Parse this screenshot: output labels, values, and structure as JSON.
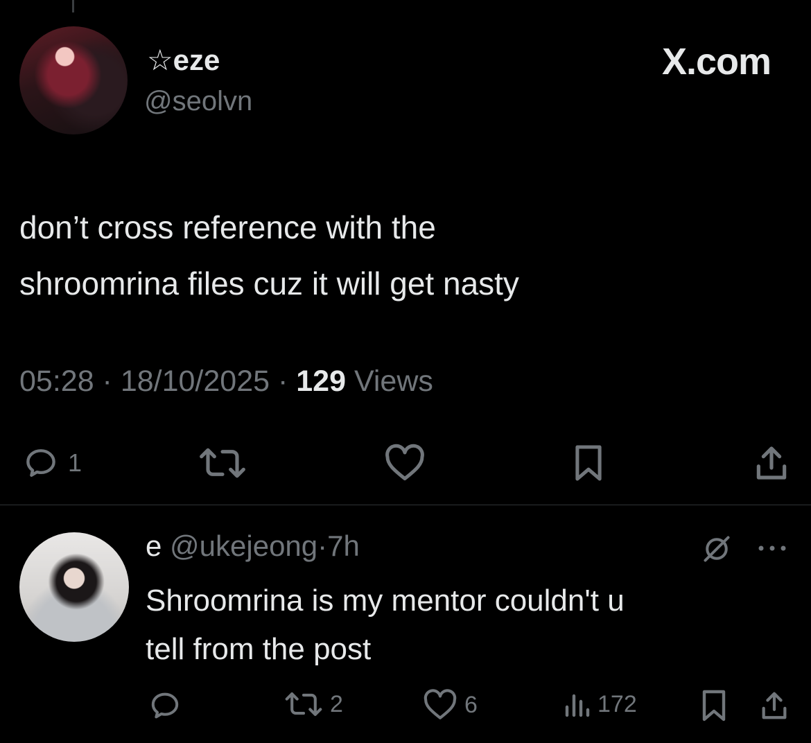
{
  "main_post": {
    "display_name": "☆eze",
    "handle": "@seolvn",
    "brand": "X.com",
    "text_line1": "don’t cross reference with the",
    "text_line2": "shroomrina files cuz it will get nasty",
    "time": "05:28",
    "separator": " · ",
    "date": "18/10/2025",
    "views_count": "129",
    "views_label": " Views",
    "actions": {
      "reply_count": "1"
    },
    "icons": [
      "reply-icon",
      "retweet-icon",
      "like-icon",
      "bookmark-icon",
      "share-icon"
    ]
  },
  "reply_post": {
    "display_name": "e",
    "handle": "@ukejeong",
    "separator": "·",
    "time": "7h",
    "text_line1": "Shroomrina is my mentor couldn't u",
    "text_line2": "tell from the post",
    "actions": {
      "reply_count": "",
      "retweet_count": "2",
      "like_count": "6",
      "views_count": "172"
    },
    "icons": [
      "grok-icon",
      "more-icon",
      "reply-icon",
      "retweet-icon",
      "like-icon",
      "views-icon",
      "bookmark-icon",
      "share-icon"
    ]
  },
  "colors": {
    "background": "#000000",
    "text": "#e7e9ea",
    "muted": "#71767b",
    "divider": "#2f3336"
  }
}
